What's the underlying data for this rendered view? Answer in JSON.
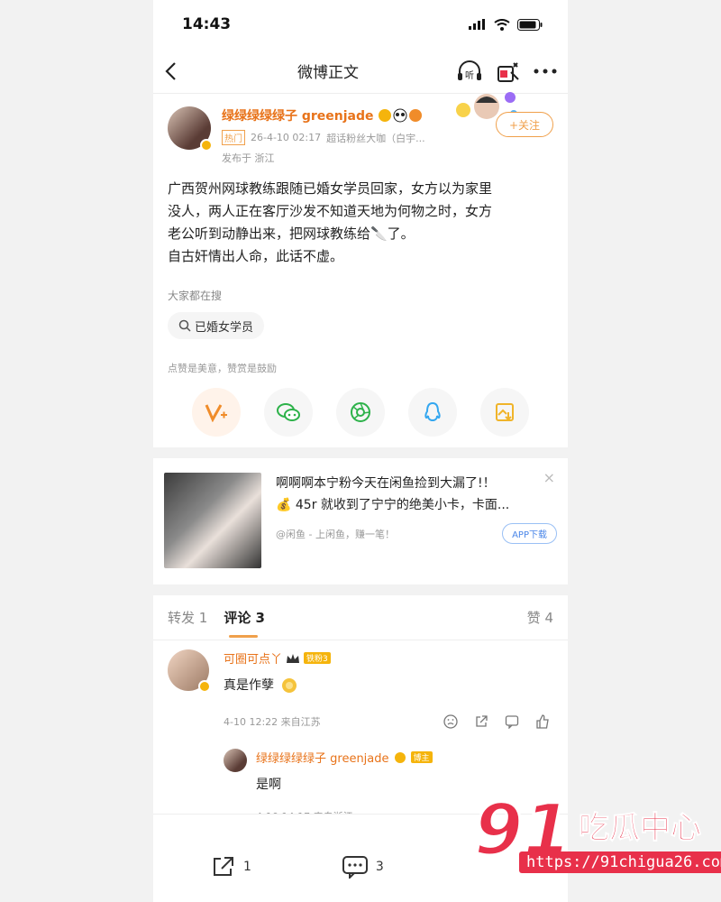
{
  "status_bar": {
    "time": "14:43"
  },
  "nav": {
    "title": "微博正文",
    "listen": "听"
  },
  "post": {
    "author_name": "绿绿绿绿绿子 greenjade",
    "hot_tag": "热门",
    "time": "26-4-10 02:17",
    "fan_title": "超话粉丝大咖（白宇...",
    "location": "发布于 浙江",
    "follow_label": "+关注",
    "content_lines": [
      "广西贺州网球教练跟随已婚女学员回家，女方以为家里",
      "没人，两人正在客厅沙发不知道天地为何物之时，女方",
      "老公听到动静出来，把网球教练给🔪了。",
      "自古奸情出人命，此话不虚。"
    ],
    "search_title": "大家都在搜",
    "search_chip": "已婚女学员",
    "like_hint": "点赞是美意，赞赏是鼓励"
  },
  "ad": {
    "line1": "啊啊啊本宁粉今天在闲鱼捡到大漏了!！",
    "line2": "💰 45r 就收到了宁宁的绝美小卡，卡面...",
    "source": "@闲鱼 - 上闲鱼，赚一笔！",
    "download": "APP下载",
    "close": "×"
  },
  "tabs": {
    "repost": "转发 1",
    "comment": "评论 3",
    "like": "赞 4"
  },
  "comments": [
    {
      "name": "可圈可点丫",
      "badge": "铁粉3",
      "text": "真是作孽",
      "meta": "4-10 12:22 来自江苏"
    }
  ],
  "reply": {
    "name": "绿绿绿绿绿子 greenjade",
    "badge": "博主",
    "text": "是啊",
    "meta": "4-10 14:17 来自浙江"
  },
  "bottom_bar": {
    "repost_count": "1",
    "comment_count": "3"
  },
  "watermark": {
    "number": "91",
    "text": "吃瓜中心",
    "url": "https://91chigua26.com"
  },
  "colors": {
    "accent": "#f0a04b",
    "name": "#e8731a",
    "watermark": "#e8304a"
  }
}
